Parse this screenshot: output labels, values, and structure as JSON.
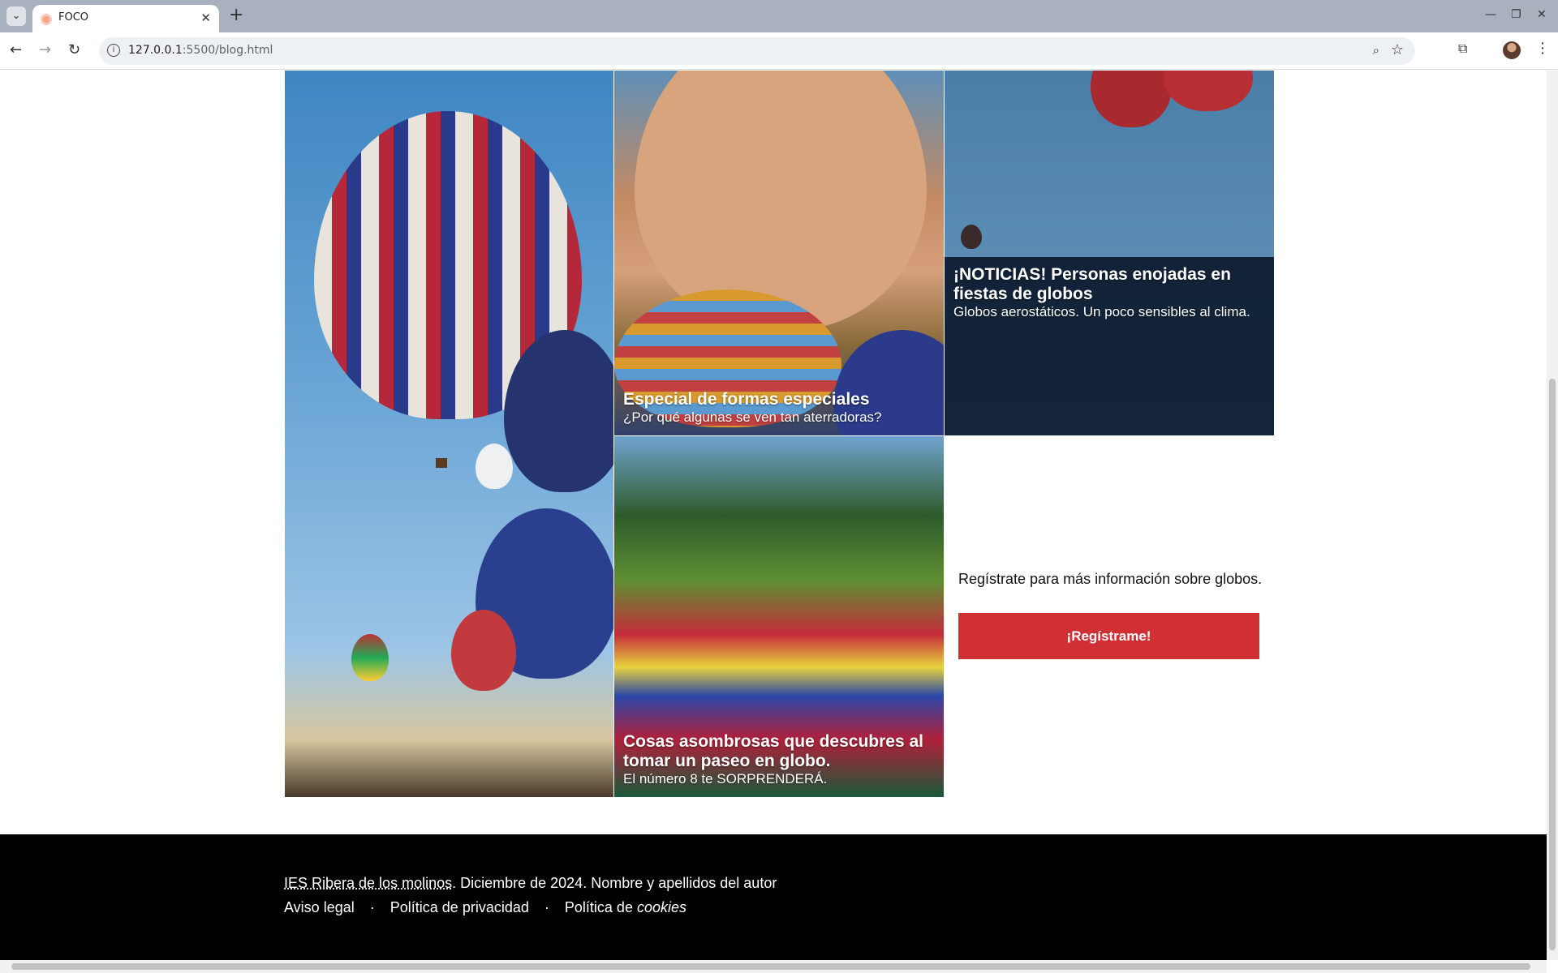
{
  "browser": {
    "tab_title": "FOCO",
    "url_host": "127.0.0.1",
    "url_path": ":5500/blog.html",
    "tab_list_icon": "chevron-down-icon",
    "new_tab_icon": "plus-icon"
  },
  "cards": [
    {
      "title": "Especial de formas especiales",
      "subtitle": "¿Por qué algunas se ven tan aterradoras?"
    },
    {
      "title": "¡NOTICIAS! Personas enojadas en fiestas de globos",
      "subtitle": "Globos aerostáticos. Un poco sensibles al clima."
    },
    {
      "title": "Cosas asombrosas que descubres al tomar un paseo en globo.",
      "subtitle": "El número 8 te SORPRENDERÁ."
    }
  ],
  "signup": {
    "text": "Regístrate para más información sobre globos.",
    "button": "¡Regístrame!"
  },
  "footer": {
    "org": "IES Ribera de los molinos",
    "rest": ". Diciembre de 2024. Nombre y apellidos del autor",
    "links": {
      "legal": "Aviso legal",
      "privacy": "Política de privacidad",
      "cookies_prefix": "Política de ",
      "cookies_em": "cookies"
    },
    "separator": "·"
  },
  "colors": {
    "accent": "#d03034",
    "footer_bg": "#000000"
  }
}
